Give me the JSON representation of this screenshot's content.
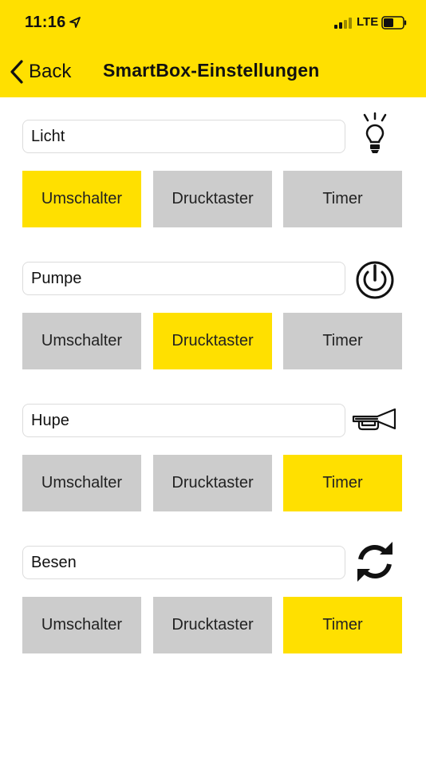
{
  "status_bar": {
    "time": "11:16",
    "network": "LTE"
  },
  "nav": {
    "back_label": "Back",
    "title": "SmartBox-Einstellungen"
  },
  "colors": {
    "accent": "#FFE000",
    "inactive": "#CCCCCC"
  },
  "sections": [
    {
      "name": "Licht",
      "icon": "lightbulb-icon",
      "selected": "Umschalter",
      "modes": [
        "Umschalter",
        "Drucktaster",
        "Timer"
      ]
    },
    {
      "name": "Pumpe",
      "icon": "power-icon",
      "selected": "Drucktaster",
      "modes": [
        "Umschalter",
        "Drucktaster",
        "Timer"
      ]
    },
    {
      "name": "Hupe",
      "icon": "horn-icon",
      "selected": "Timer",
      "modes": [
        "Umschalter",
        "Drucktaster",
        "Timer"
      ]
    },
    {
      "name": "Besen",
      "icon": "refresh-icon",
      "selected": "Timer",
      "modes": [
        "Umschalter",
        "Drucktaster",
        "Timer"
      ]
    }
  ]
}
